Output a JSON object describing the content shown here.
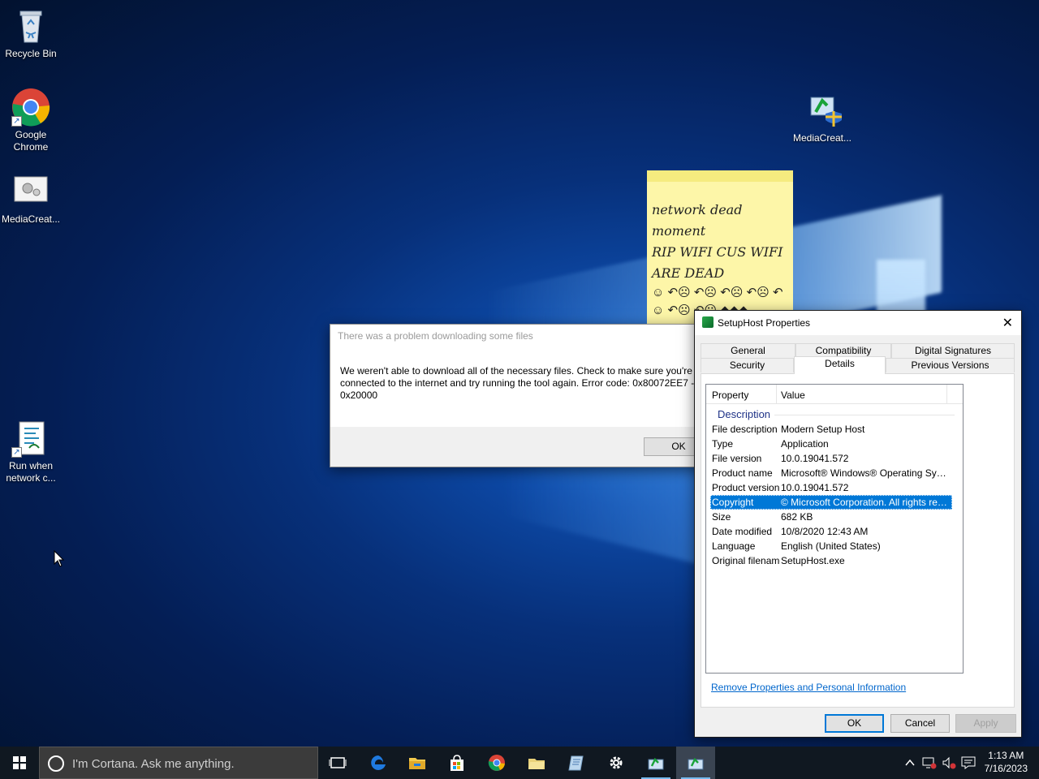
{
  "desktop": {
    "icons": [
      {
        "label": "Recycle Bin",
        "icon": "recycle-bin-icon"
      },
      {
        "label": "Google Chrome",
        "icon": "chrome-icon"
      },
      {
        "label": "MediaCreat...",
        "icon": "media-creation-tool-icon"
      },
      {
        "label": "Run when network c...",
        "icon": "script-icon"
      },
      {
        "label": "MediaCreat...",
        "icon": "media-creation-setup-icon"
      }
    ]
  },
  "sticky_note": {
    "lines": [
      "network dead",
      "moment",
      "RIP WIFI CUS WIFI",
      "ARE DEAD"
    ],
    "emoji_line_1": "☺ ↶☹ ↶☹ ↶☹ ↶☹ ↶",
    "emoji_line_2": "☺ ↶☹ ↶☹ ◆◆◆"
  },
  "error_dialog": {
    "title": "There was a problem downloading some files",
    "message": "We weren't able to download all of the necessary files. Check to make sure you're connected to the internet and try running the tool again. Error code: 0x80072EE7 - 0x20000",
    "ok_label": "OK"
  },
  "properties_dialog": {
    "title": "SetupHost Properties",
    "tabs_row1": [
      "General",
      "Compatibility",
      "Digital Signatures"
    ],
    "tabs_row2": [
      "Security",
      "Details",
      "Previous Versions"
    ],
    "active_tab": "Details",
    "columns": [
      "Property",
      "Value"
    ],
    "group": "Description",
    "rows": [
      {
        "property": "File description",
        "value": "Modern Setup Host"
      },
      {
        "property": "Type",
        "value": "Application"
      },
      {
        "property": "File version",
        "value": "10.0.19041.572"
      },
      {
        "property": "Product name",
        "value": "Microsoft® Windows® Operating System"
      },
      {
        "property": "Product version",
        "value": "10.0.19041.572"
      },
      {
        "property": "Copyright",
        "value": "© Microsoft Corporation. All rights reserv..."
      },
      {
        "property": "Size",
        "value": "682 KB"
      },
      {
        "property": "Date modified",
        "value": "10/8/2020 12:43 AM"
      },
      {
        "property": "Language",
        "value": "English (United States)"
      },
      {
        "property": "Original filename",
        "value": "SetupHost.exe"
      }
    ],
    "selected_row": "Copyright",
    "remove_link": "Remove Properties and Personal Information",
    "ok_label": "OK",
    "cancel_label": "Cancel",
    "apply_label": "Apply"
  },
  "taskbar": {
    "search_placeholder": "I'm Cortana. Ask me anything.",
    "time": "1:13 AM",
    "date": "7/16/2023",
    "accent": "#76b9ed"
  }
}
